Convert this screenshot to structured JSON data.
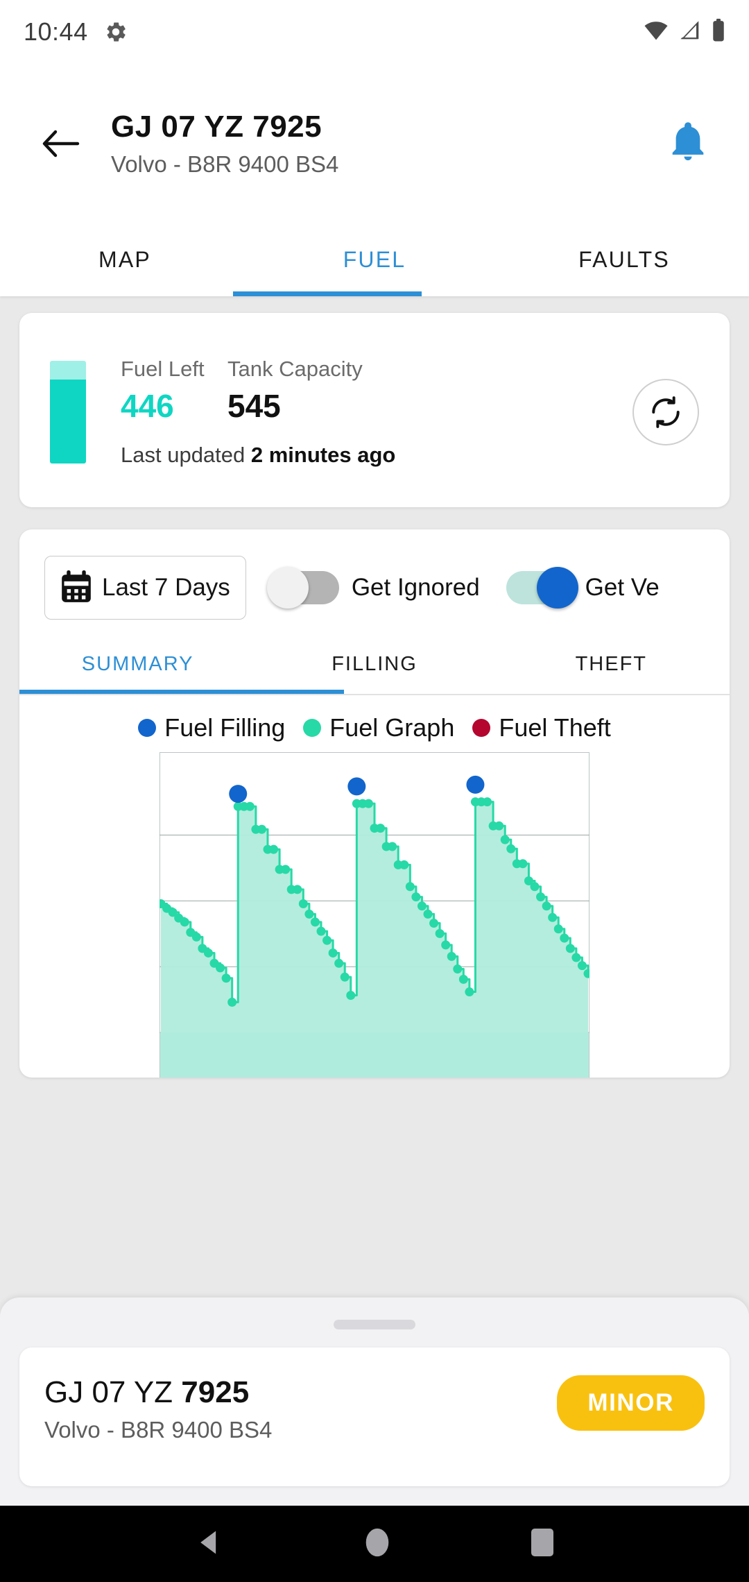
{
  "status_bar": {
    "time": "10:44",
    "icons": [
      "gear-icon",
      "wifi-icon",
      "cellular-signal-icon",
      "battery-icon"
    ]
  },
  "app_bar": {
    "back_icon": "arrow-left-icon",
    "title": "GJ 07 YZ 7925",
    "subtitle": "Volvo - B8R 9400 BS4",
    "notification_icon": "bell-icon",
    "notification_color": "#2d8fd5"
  },
  "tabs": {
    "items": [
      {
        "label": "MAP",
        "active": false
      },
      {
        "label": "FUEL",
        "active": true
      },
      {
        "label": "FAULTS",
        "active": false
      }
    ],
    "active_color": "#2d8fd5"
  },
  "fuel_card": {
    "fuel_left_label": "Fuel Left",
    "fuel_left_value": "446",
    "tank_capacity_label": "Tank Capacity",
    "tank_capacity_value": "545",
    "last_updated_prefix": "Last updated",
    "last_updated_value": "2 minutes ago",
    "refresh_icon": "refresh-sync-icon",
    "gauge_fill_percent": 82,
    "gauge_color": "#0fd6c3",
    "gauge_empty_color": "#9ff0e6"
  },
  "graph_card": {
    "date_range_button": {
      "label": "Last 7 Days",
      "icon": "calendar-icon"
    },
    "toggles": [
      {
        "label": "Get Ignored",
        "on": false
      },
      {
        "label": "Get Ve",
        "on": true
      }
    ],
    "subtabs": [
      {
        "label": "SUMMARY",
        "active": true
      },
      {
        "label": "FILLING",
        "active": false
      },
      {
        "label": "THEFT",
        "active": false
      }
    ]
  },
  "chart_data": {
    "type": "line",
    "title": "",
    "xlabel": "",
    "ylabel": "",
    "grid": true,
    "legend_position": "top",
    "ylim": [
      0,
      560
    ],
    "series": [
      {
        "name": "Fuel Graph",
        "color": "#27d9a6",
        "fill_color": "#b0ecdc",
        "points": [
          [
            0,
            300
          ],
          [
            1,
            292
          ],
          [
            2,
            285
          ],
          [
            3,
            275
          ],
          [
            4,
            268
          ],
          [
            5,
            250
          ],
          [
            6,
            242
          ],
          [
            7,
            222
          ],
          [
            8,
            214
          ],
          [
            9,
            196
          ],
          [
            10,
            188
          ],
          [
            11,
            170
          ],
          [
            12,
            128
          ],
          [
            13,
            470
          ],
          [
            14,
            470
          ],
          [
            15,
            470
          ],
          [
            16,
            430
          ],
          [
            17,
            430
          ],
          [
            18,
            395
          ],
          [
            19,
            395
          ],
          [
            20,
            360
          ],
          [
            21,
            360
          ],
          [
            22,
            325
          ],
          [
            23,
            325
          ],
          [
            24,
            300
          ],
          [
            25,
            282
          ],
          [
            26,
            268
          ],
          [
            27,
            252
          ],
          [
            28,
            236
          ],
          [
            29,
            214
          ],
          [
            30,
            196
          ],
          [
            31,
            172
          ],
          [
            32,
            140
          ],
          [
            33,
            475
          ],
          [
            34,
            475
          ],
          [
            35,
            475
          ],
          [
            36,
            432
          ],
          [
            37,
            432
          ],
          [
            38,
            400
          ],
          [
            39,
            400
          ],
          [
            40,
            368
          ],
          [
            41,
            368
          ],
          [
            42,
            330
          ],
          [
            43,
            312
          ],
          [
            44,
            296
          ],
          [
            45,
            282
          ],
          [
            46,
            266
          ],
          [
            47,
            248
          ],
          [
            48,
            228
          ],
          [
            49,
            208
          ],
          [
            50,
            186
          ],
          [
            51,
            168
          ],
          [
            52,
            146
          ],
          [
            53,
            478
          ],
          [
            54,
            478
          ],
          [
            55,
            478
          ],
          [
            56,
            436
          ],
          [
            57,
            436
          ],
          [
            58,
            412
          ],
          [
            59,
            396
          ],
          [
            60,
            370
          ],
          [
            61,
            370
          ],
          [
            62,
            340
          ],
          [
            63,
            330
          ],
          [
            64,
            312
          ],
          [
            65,
            296
          ],
          [
            66,
            276
          ],
          [
            67,
            256
          ],
          [
            68,
            240
          ],
          [
            69,
            222
          ],
          [
            70,
            206
          ],
          [
            71,
            192
          ],
          [
            72,
            178
          ]
        ]
      }
    ],
    "markers": [
      {
        "name": "Fuel Filling",
        "color": "#1265cc",
        "points": [
          [
            13,
            492
          ],
          [
            33,
            505
          ],
          [
            53,
            508
          ]
        ]
      },
      {
        "name": "Fuel Theft",
        "color": "#b4062f",
        "points": []
      }
    ],
    "legend": [
      {
        "label": "Fuel Filling",
        "color": "#1265cc"
      },
      {
        "label": "Fuel Graph",
        "color": "#27d9a6"
      },
      {
        "label": "Fuel Theft",
        "color": "#b4062f"
      }
    ],
    "gridlines_y": [
      420,
      305,
      190,
      75
    ]
  },
  "bottom_sheet": {
    "vehicle_prefix": "GJ 07 YZ ",
    "vehicle_number_bold": "7925",
    "vehicle_model": "Volvo - B8R 9400 BS4",
    "badge": "MINOR",
    "badge_color": "#f9c10f"
  },
  "nav_bar": {
    "back_icon": "triangle-back-icon",
    "home_icon": "circle-home-icon",
    "recents_icon": "square-recents-icon"
  }
}
